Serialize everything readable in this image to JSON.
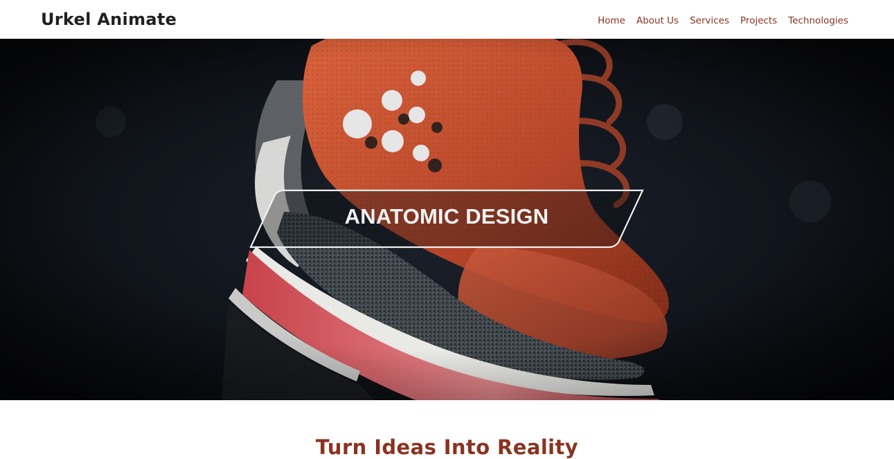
{
  "header": {
    "brand": "Urkel Animate",
    "nav": [
      {
        "label": "Home"
      },
      {
        "label": "About Us"
      },
      {
        "label": "Services"
      },
      {
        "label": "Projects"
      },
      {
        "label": "Technologies"
      }
    ]
  },
  "hero": {
    "caption": "ANATOMIC DESIGN"
  },
  "intro": {
    "title": "Turn Ideas Into Reality"
  },
  "colors": {
    "accent": "#8a3320",
    "brand_text": "#1f1f1f",
    "hero_background": "#0b0d12",
    "shoe_orange": "#c8502f"
  }
}
